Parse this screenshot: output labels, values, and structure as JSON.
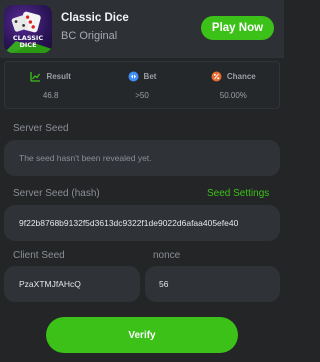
{
  "game": {
    "title": "Classic Dice",
    "subtitle": "BC Original",
    "play_label": "Play Now",
    "logo_text": [
      "CLASSIC",
      "DICE"
    ]
  },
  "stats": [
    {
      "label": "Result",
      "value": "46.8",
      "icon": "trend-icon",
      "color": "#3bc117"
    },
    {
      "label": "Bet",
      "value": ">50",
      "icon": "bet-icon",
      "color": "#3e8ef7"
    },
    {
      "label": "Chance",
      "value": "50.00%",
      "icon": "percent-icon",
      "color": "#e86b2d"
    }
  ],
  "server_seed": {
    "label": "Server Seed",
    "value": "The seed hasn't been revealed yet."
  },
  "server_seed_hash": {
    "label": "Server Seed (hash)",
    "settings_link": "Seed Settings",
    "value": "9f22b8768b9132f5d3613dc9322f1de9022d6afaa405efe40"
  },
  "client_seed": {
    "label": "Client Seed",
    "value": "PzaXTMJfAHcQ"
  },
  "nonce": {
    "label": "nonce",
    "value": "56"
  },
  "verify_label": "Verify",
  "colors": {
    "accent": "#3bc117",
    "background": "#232527",
    "panel": "#2f3237"
  }
}
